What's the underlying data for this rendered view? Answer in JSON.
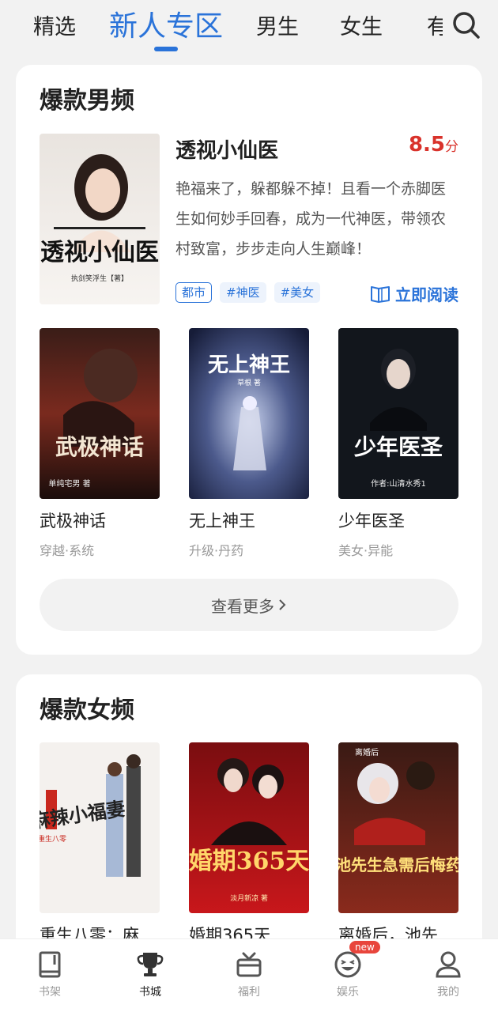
{
  "top_tabs": [
    "精选",
    "新人专区",
    "男生",
    "女生",
    "有"
  ],
  "active_tab": "新人专区",
  "section_male": {
    "title": "爆款男频",
    "featured": {
      "title": "透视小仙医",
      "rating_value": "8.5",
      "rating_unit": "分",
      "description": "艳福来了，躲都躲不掉！且看一个赤脚医生如何妙手回春，成为一代神医，带领农村致富，步步走向人生巅峰！",
      "tags": [
        "都市",
        "#神医",
        "#美女"
      ],
      "read_label": "立即阅读",
      "cover_text": "透视小仙医",
      "cover_author": "执剑笑浮生【著】"
    },
    "books": [
      {
        "title": "武极神话",
        "sub": "穿越·系统",
        "cover_text": "武极神话",
        "cover_author": "单纯宅男 著"
      },
      {
        "title": "无上神王",
        "sub": "升级·丹药",
        "cover_text": "无上神王",
        "cover_author": "草根 著"
      },
      {
        "title": "少年医圣",
        "sub": "美女·异能",
        "cover_text": "少年医圣",
        "cover_author": "作者:山清水秀1"
      }
    ],
    "more_label": "查看更多"
  },
  "section_female": {
    "title": "爆款女频",
    "books": [
      {
        "title": "重生八零：麻",
        "cover_text": "麻辣小福妻",
        "cover_author": "重生八零"
      },
      {
        "title": "婚期365天",
        "cover_text": "婚期365天",
        "cover_author": "淡月新凉 著"
      },
      {
        "title": "离婚后，池先",
        "cover_text": "池先生急需后悔药",
        "cover_author": "离婚后"
      }
    ]
  },
  "bottom_nav": [
    {
      "label": "书架",
      "icon": "bookshelf-icon"
    },
    {
      "label": "书城",
      "icon": "trophy-icon"
    },
    {
      "label": "福利",
      "icon": "gift-icon"
    },
    {
      "label": "娱乐",
      "icon": "smile-icon",
      "badge": "new"
    },
    {
      "label": "我的",
      "icon": "user-icon"
    }
  ],
  "active_nav": "书城",
  "colors": {
    "accent": "#2a73d9",
    "rating": "#d9322b",
    "badge": "#e8453c"
  }
}
